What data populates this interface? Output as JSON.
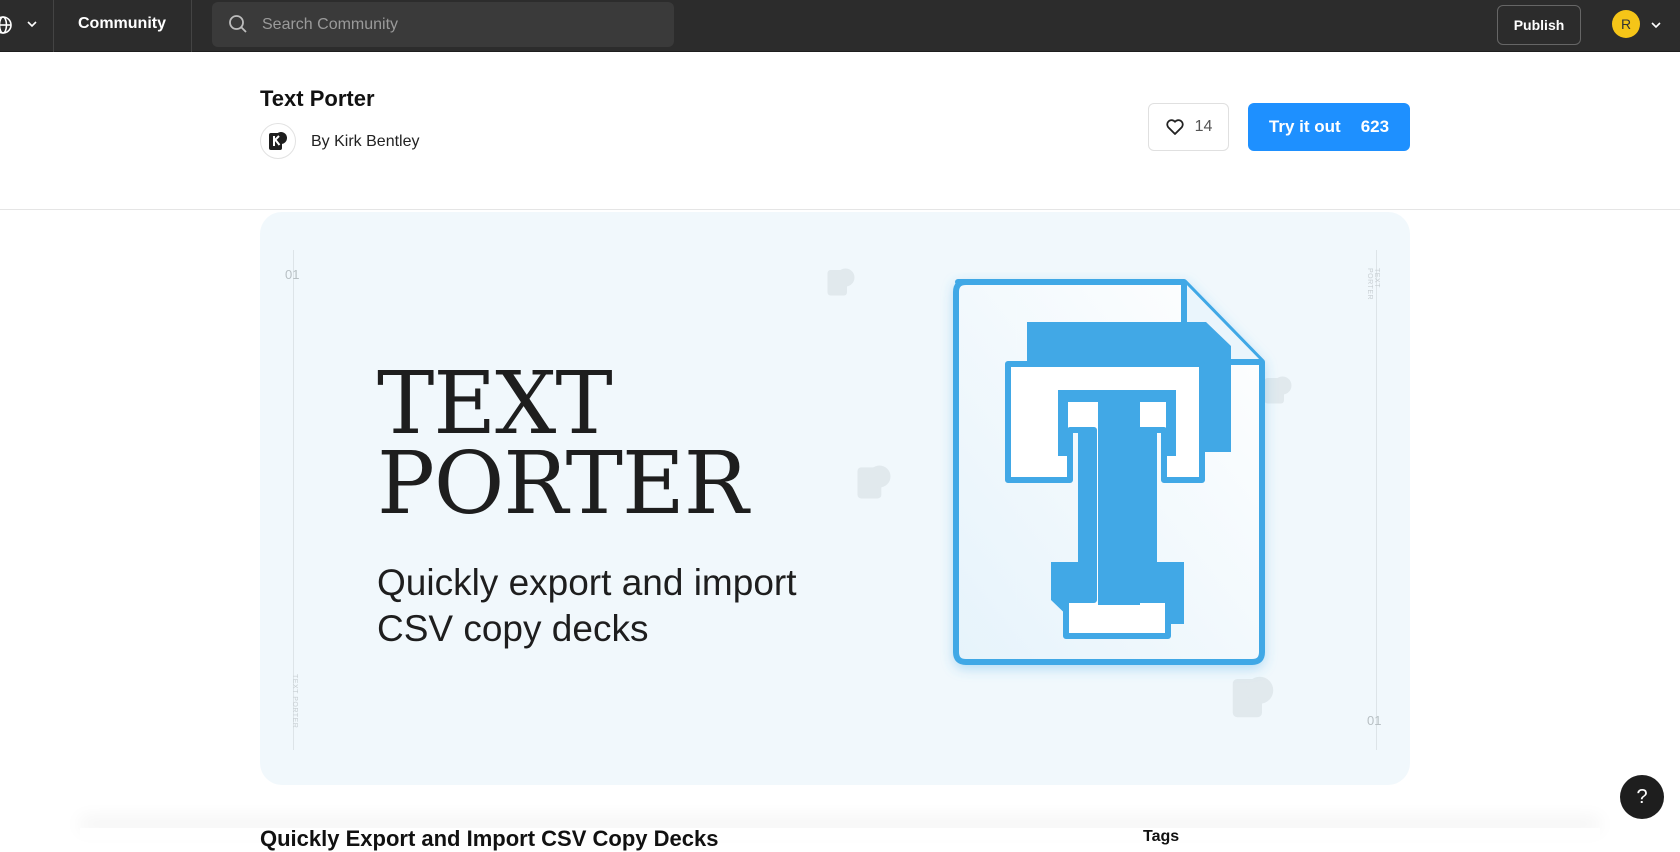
{
  "topbar": {
    "community_label": "Community",
    "search_placeholder": "Search Community",
    "publish_label": "Publish",
    "avatar_initial": "R"
  },
  "plugin": {
    "title": "Text Porter",
    "author": "By Kirk Bentley",
    "likes": "14",
    "try_label": "Try it out",
    "try_count": "623"
  },
  "hero": {
    "title_line1": "TEXT",
    "title_line2": "PORTER",
    "subtitle_line1": "Quickly export and import",
    "subtitle_line2": "CSV copy decks",
    "tick_top": "01",
    "tick_bottom": "01",
    "side_label": "TEXT PORTER",
    "accent_color": "#41a8e6"
  },
  "details": {
    "heading": "Quickly Export and Import CSV Copy Decks",
    "tags_label": "Tags"
  },
  "help_label": "?",
  "icons": [
    "globe-icon",
    "chevron-down-icon",
    "search-icon",
    "heart-icon",
    "k-logo-icon",
    "document-t-icon",
    "help-icon"
  ]
}
